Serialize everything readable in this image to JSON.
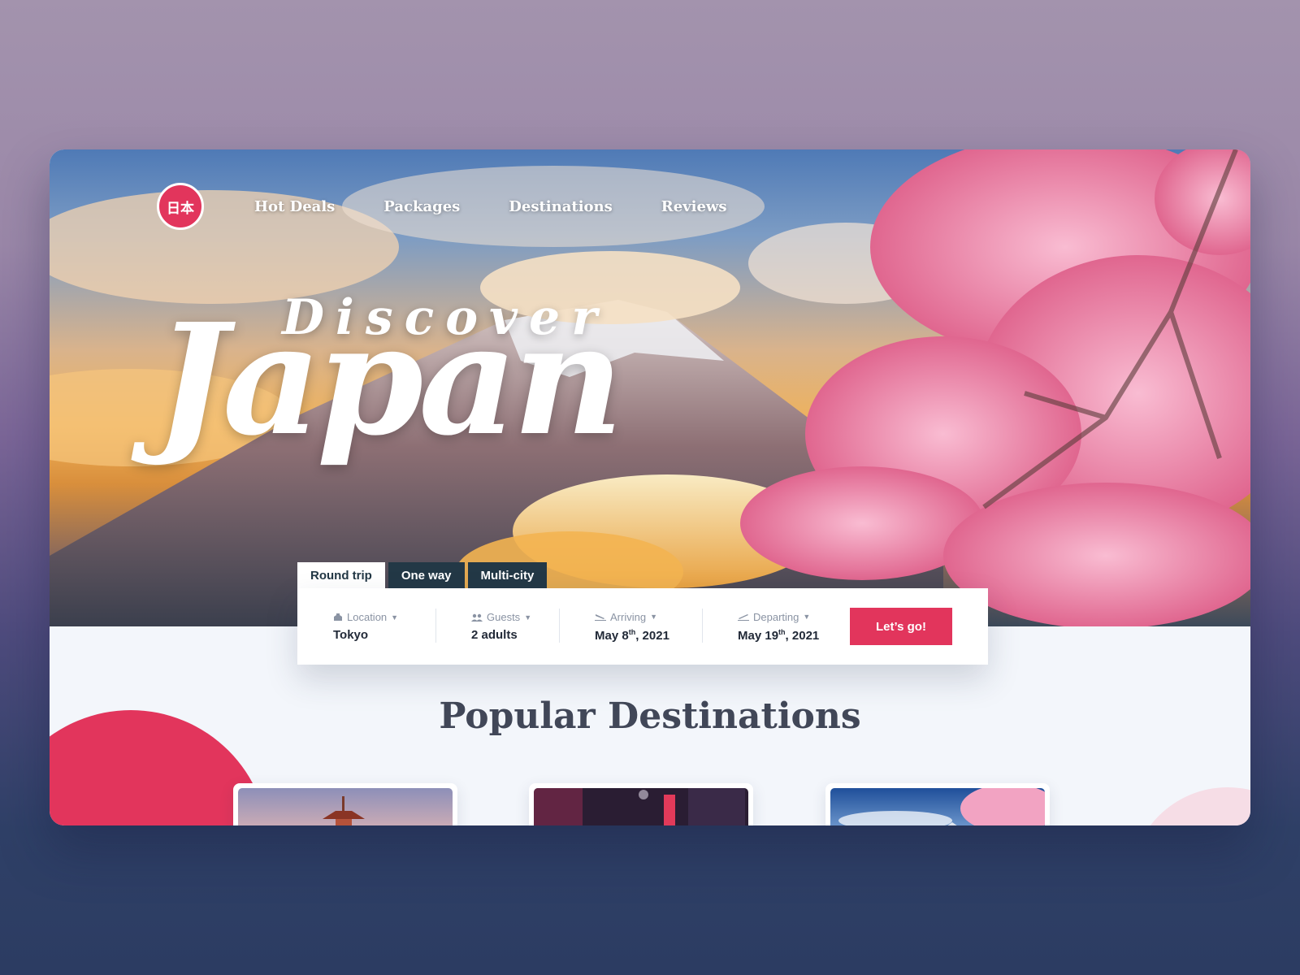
{
  "brand": {
    "logo_text": "日本",
    "accent": "#e2355c",
    "dark": "#233846"
  },
  "nav": {
    "items": [
      "Hot Deals",
      "Packages",
      "Destinations",
      "Reviews"
    ]
  },
  "hero": {
    "title_small": "Discover",
    "title_large": "Japan"
  },
  "booking": {
    "tabs": [
      "Round trip",
      "One way",
      "Multi-city"
    ],
    "active_tab": "Round trip",
    "fields": [
      {
        "icon": "location-icon",
        "label": "Location",
        "value": "Tokyo"
      },
      {
        "icon": "guests-icon",
        "label": "Guests",
        "value": "2 adults"
      },
      {
        "icon": "plane-landing-icon",
        "label": "Arriving",
        "value_main": "May 8",
        "value_sup": "th",
        "value_tail": ", 2021"
      },
      {
        "icon": "plane-departing-icon",
        "label": "Departing",
        "value_main": "May 19",
        "value_sup": "th",
        "value_tail": ", 2021"
      }
    ],
    "submit_label": "Let’s go!"
  },
  "popular": {
    "title": "Popular Destinations"
  }
}
